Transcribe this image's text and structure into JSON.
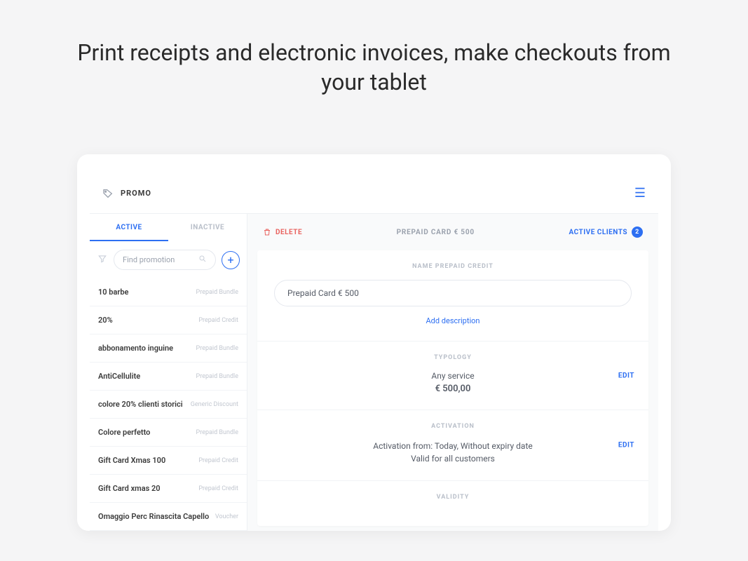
{
  "hero": "Print receipts and electronic invoices, make checkouts from your tablet",
  "header": {
    "title": "PROMO"
  },
  "sidebar": {
    "tabs": {
      "active": "ACTIVE",
      "inactive": "INACTIVE"
    },
    "search_placeholder": "Find promotion",
    "items": [
      {
        "name": "10 barbe",
        "type": "Prepaid Bundle"
      },
      {
        "name": "20%",
        "type": "Prepaid Credit"
      },
      {
        "name": "abbonamento inguine",
        "type": "Prepaid Bundle"
      },
      {
        "name": "AntiCellulite",
        "type": "Prepaid Bundle"
      },
      {
        "name": "colore 20% clienti storici",
        "type": "Generic Discount"
      },
      {
        "name": "Colore perfetto",
        "type": "Prepaid Bundle"
      },
      {
        "name": "Gift Card Xmas 100",
        "type": "Prepaid Credit"
      },
      {
        "name": "Gift Card xmas 20",
        "type": "Prepaid Credit"
      },
      {
        "name": "Omaggio Perc Rinascita Capello",
        "type": "Voucher"
      }
    ]
  },
  "main": {
    "delete_label": "DELETE",
    "title": "PREPAID CARD € 500",
    "active_clients_label": "ACTIVE CLIENTS",
    "active_clients_count": "2",
    "name_section_label": "NAME PREPAID CREDIT",
    "name_value": "Prepaid Card € 500",
    "add_description": "Add description",
    "typology_label": "TYPOLOGY",
    "typology_text": "Any service",
    "typology_price": "€ 500,00",
    "activation_label": "ACTIVATION",
    "activation_line1": "Activation from: Today, Without expiry date",
    "activation_line2": "Valid for all customers",
    "validity_label": "VALIDITY",
    "edit_label": "EDIT"
  }
}
